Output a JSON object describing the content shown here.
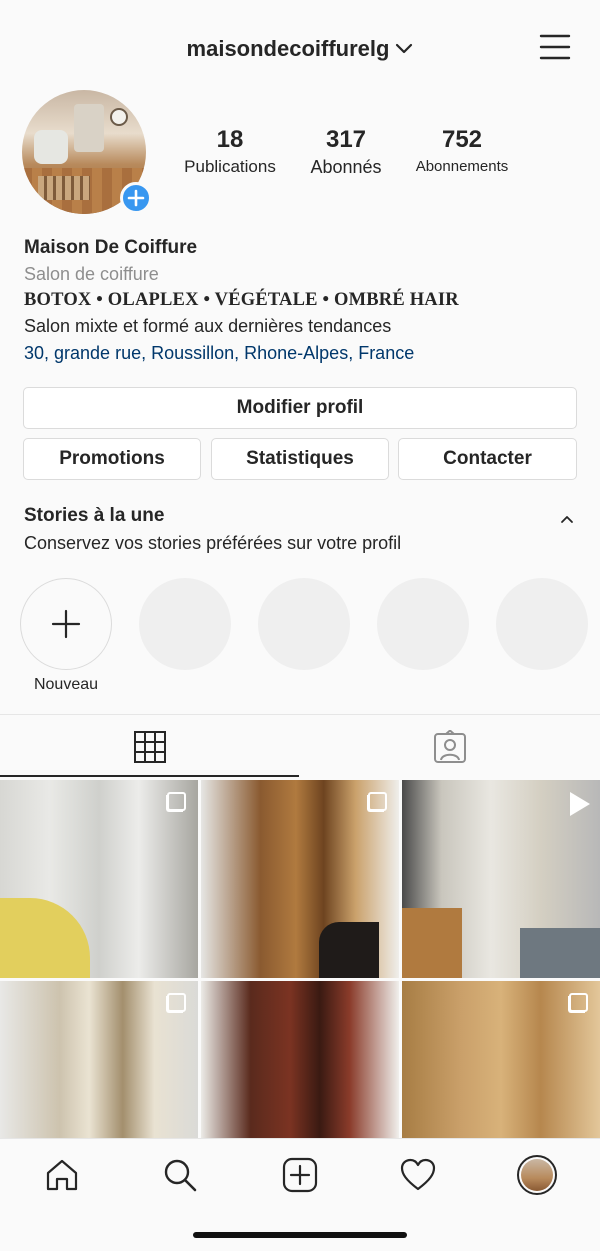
{
  "header": {
    "username": "maisondecoiffurelg",
    "username_chevron_icon": "chevron-down-icon",
    "menu_icon": "hamburger-menu-icon"
  },
  "profile": {
    "avatar_icon": "profile-photo",
    "add_story_icon": "plus-circle-icon",
    "stats": [
      {
        "value": "18",
        "label": "Publications"
      },
      {
        "value": "317",
        "label": "Abonnés"
      },
      {
        "value": "752",
        "label": "Abonnements"
      }
    ]
  },
  "bio": {
    "name": "Maison De Coiffure",
    "category": "Salon de coiffure",
    "tags": "BOTOX • OLAPLEX • VÉGÉTALE • OMBRÉ HAIR",
    "description": "Salon mixte et formé aux dernières tendances",
    "address": "30, grande rue, Roussillon, Rhone-Alpes, France"
  },
  "actions": {
    "edit_profile": "Modifier profil",
    "promotions": "Promotions",
    "statistics": "Statistiques",
    "contact": "Contacter"
  },
  "highlights": {
    "title": "Stories à la une",
    "subtitle": "Conservez vos stories préférées sur votre profil",
    "new_label": "Nouveau",
    "collapse_icon": "chevron-up-icon"
  },
  "tabs": [
    {
      "name": "grid",
      "icon": "grid-icon",
      "active": true
    },
    {
      "name": "tagged",
      "icon": "tagged-person-icon",
      "active": false
    }
  ],
  "posts": [
    {
      "badge": "carousel"
    },
    {
      "badge": "carousel"
    },
    {
      "badge": "video"
    },
    {
      "badge": "carousel"
    },
    {
      "badge": "none"
    },
    {
      "badge": "carousel"
    }
  ],
  "bottom_nav": [
    "home-icon",
    "search-icon",
    "new-post-icon",
    "activity-heart-icon",
    "profile-avatar"
  ],
  "colors": {
    "link": "#00376b",
    "accent": "#3897f0",
    "text": "#262626",
    "secondary": "#8e8e8e",
    "background": "#fafafa",
    "border": "#dbdbdb"
  }
}
